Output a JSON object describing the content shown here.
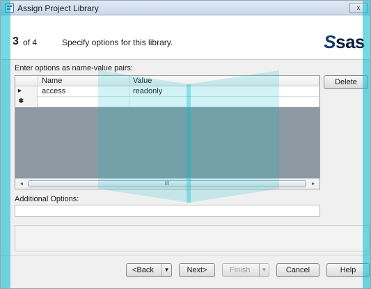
{
  "window": {
    "title": "Assign Project Library",
    "close_label": "x"
  },
  "header": {
    "step_number": "3",
    "step_of": "of 4",
    "description": "Specify options for this library.",
    "logo": {
      "s": "S",
      "rest": "sas"
    }
  },
  "options": {
    "label": "Enter options as name-value pairs:",
    "columns": [
      "Name",
      "Value"
    ],
    "rows": [
      {
        "indicator": "▸",
        "name": "access",
        "value": "readonly"
      },
      {
        "indicator": "✱",
        "name": "",
        "value": ""
      }
    ],
    "delete_label": "Delete",
    "scroll_left": "◂",
    "scroll_right": "▸",
    "scroll_grip": "III"
  },
  "additional": {
    "label": "Additional Options:",
    "value": ""
  },
  "buttons": {
    "back": "<Back",
    "next": "Next>",
    "finish": "Finish",
    "cancel": "Cancel",
    "help": "Help",
    "dropdown_glyph": "▼"
  },
  "colors": {
    "watermark": "#00bccd",
    "grid_empty": "#8e9aa3"
  }
}
